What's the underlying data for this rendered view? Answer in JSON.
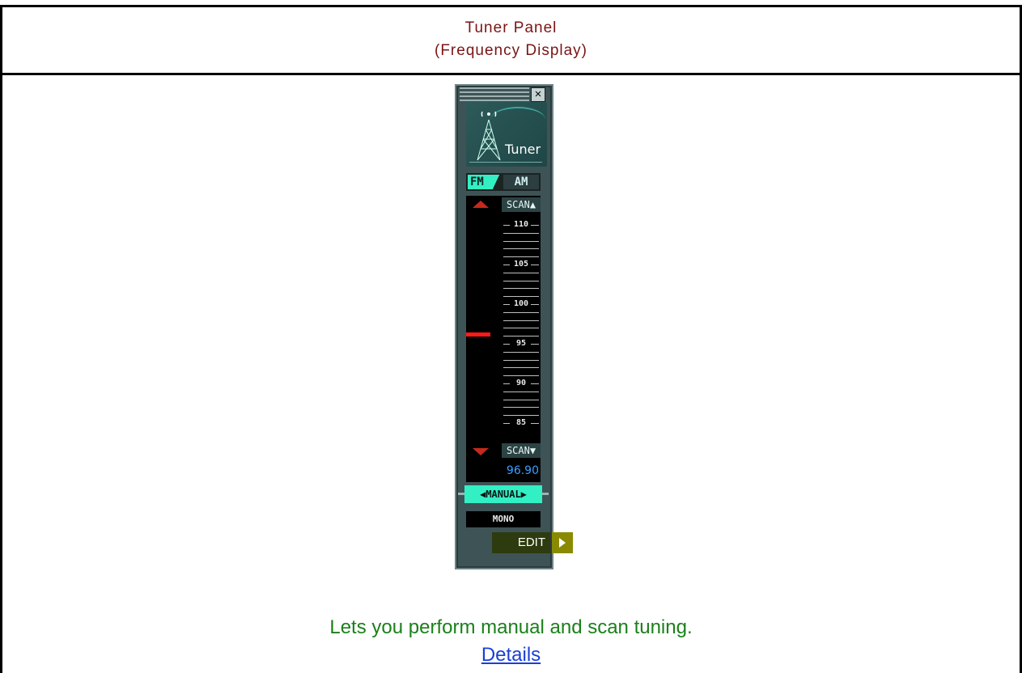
{
  "header": {
    "title": "Tuner Panel",
    "subtitle": "(Frequency Display)"
  },
  "tuner": {
    "brand": "Tuner",
    "close_label": "×",
    "band_fm": "FM",
    "band_am": "AM",
    "selected_band": "FM",
    "scan_up_label": "SCAN▲",
    "scan_down_label": "SCAN▼",
    "scale_labels": [
      "110",
      "105",
      "100",
      "95",
      "90",
      "85"
    ],
    "frequency": "96.90",
    "mode_label": "◀MANUAL▶",
    "stereo_label": "MONO",
    "edit_label": "EDIT"
  },
  "description": "Lets you perform manual and scan tuning.",
  "details_link": "Details",
  "colors": {
    "title_text": "#7a1414",
    "description_text": "#1a801a",
    "link": "#1a3fd6",
    "accent": "#32f0c4",
    "pointer": "#ff1a1a",
    "frequency_text": "#3aa0ff"
  }
}
